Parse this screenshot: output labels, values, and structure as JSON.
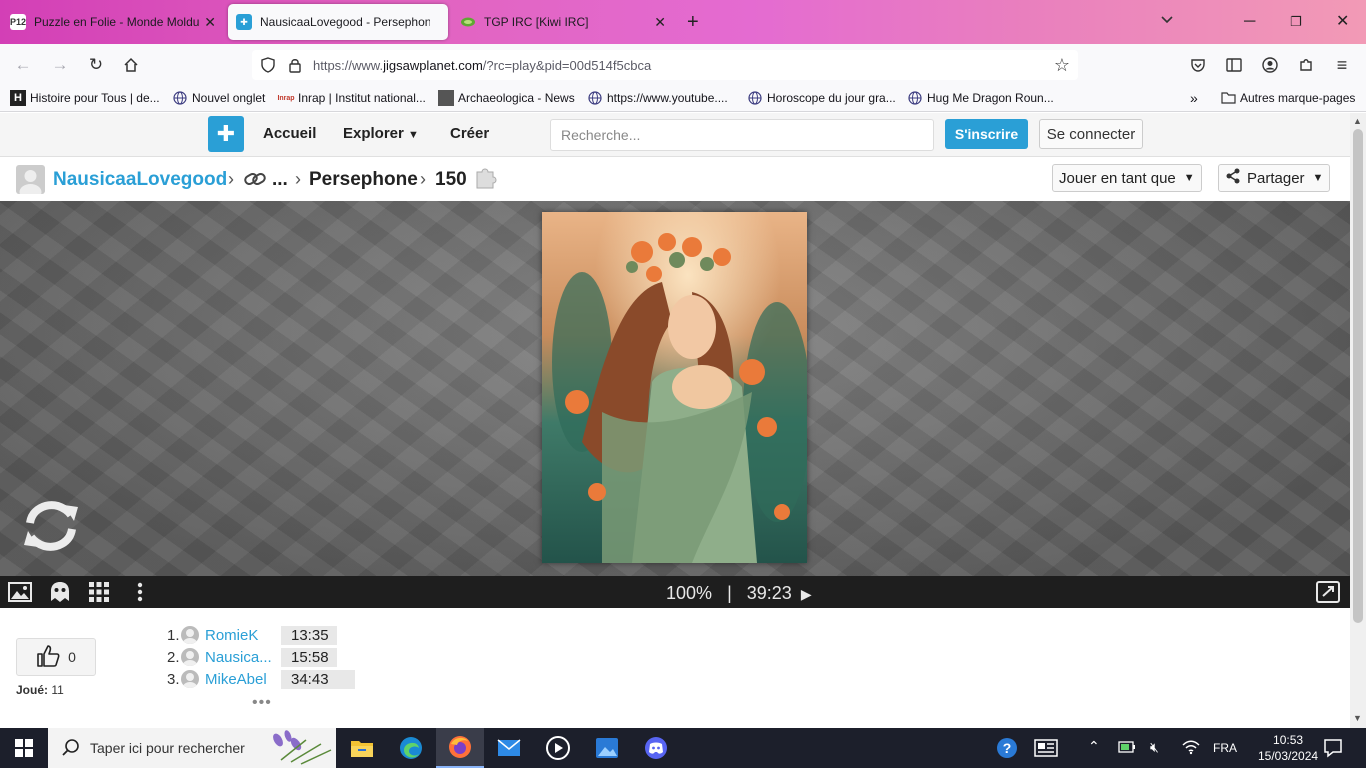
{
  "browser": {
    "tabs": [
      {
        "title": "Puzzle en Folie - Monde Moldu",
        "favicon": "P12",
        "active": false
      },
      {
        "title": "NausicaaLovegood - Persephone",
        "favicon": "jigsaw",
        "active": true
      },
      {
        "title": "TGP IRC [Kiwi IRC]",
        "favicon": "kiwi",
        "active": false
      }
    ],
    "url_prefix": "https://www.",
    "url_domain": "jigsawplanet.com",
    "url_path": "/?rc=play&pid=00d514f5cbca",
    "bookmarks": [
      {
        "label": "Histoire pour Tous | de...",
        "icon": "H"
      },
      {
        "label": "Nouvel onglet",
        "icon": "globe"
      },
      {
        "label": "Inrap | Institut national...",
        "icon": "inrap"
      },
      {
        "label": "Archaeologica - News",
        "icon": "archaeologica"
      },
      {
        "label": "https://www.youtube....",
        "icon": "globe"
      },
      {
        "label": "Horoscope du jour gra...",
        "icon": "globe"
      },
      {
        "label": "Hug Me Dragon Roun...",
        "icon": "globe"
      }
    ],
    "other_bookmarks": "Autres marque-pages"
  },
  "site": {
    "nav": {
      "home": "Accueil",
      "explore": "Explorer",
      "create": "Créer"
    },
    "search_placeholder": "Recherche...",
    "signup": "S'inscrire",
    "login": "Se connecter"
  },
  "breadcrumb": {
    "user": "NausicaaLovegood",
    "ellipsis": "...",
    "title": "Persephone",
    "pieces": "150",
    "play_as": "Jouer en tant que",
    "share": "Partager"
  },
  "player": {
    "zoom": "100%",
    "separator": "|",
    "timer": "39:23"
  },
  "stats": {
    "likes": "0",
    "played_label": "Joué:",
    "played_count": "11",
    "leaderboard": [
      {
        "rank": "1.",
        "name": "RomieK",
        "time": "13:35"
      },
      {
        "rank": "2.",
        "name": "Nausica...",
        "time": "15:58"
      },
      {
        "rank": "3.",
        "name": "MikeAbel",
        "time": "34:43"
      }
    ]
  },
  "taskbar": {
    "search_placeholder": "Taper ici pour rechercher",
    "lang": "FRA",
    "time": "10:53",
    "date": "15/03/2024"
  },
  "colors": {
    "accent": "#2a9fd6",
    "tabbar_gradient_start": "#d33fb6",
    "taskbar": "#1c1f2b"
  }
}
